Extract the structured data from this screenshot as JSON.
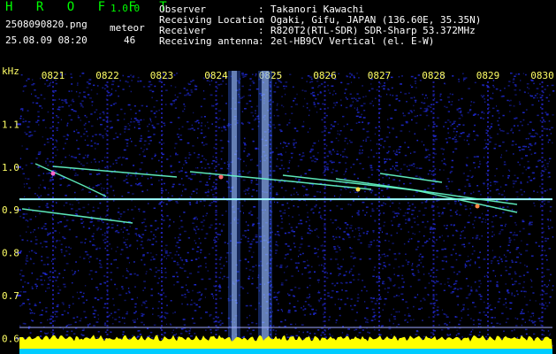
{
  "header": {
    "app_name": "H R O F F T",
    "version": "1.0.0",
    "filename": "2508090820.png",
    "datetime": "25.08.09 08:20",
    "meteor_label": "meteor",
    "meteor_count": "46",
    "info": [
      {
        "label": "Observer",
        "sep": ":",
        "value": "Takanori Kawachi"
      },
      {
        "label": "Receiving Location",
        "sep": ":",
        "value": "Ogaki, Gifu, JAPAN (136.60E, 35.35N)"
      },
      {
        "label": "Receiver",
        "sep": ":",
        "value": "R820T2(RTL-SDR) SDR-Sharp 53.372MHz"
      },
      {
        "label": "Receiving antenna",
        "sep": ":",
        "value": "2el-HB9CV Vertical (el. E-W)"
      }
    ]
  },
  "chart_data": {
    "type": "heatmap",
    "ylabel": "kHz",
    "x_ticks": [
      "0821",
      "0822",
      "0823",
      "0824",
      "0825",
      "0826",
      "0827",
      "0828",
      "0829",
      "0830"
    ],
    "y_ticks": [
      "1.1",
      "1.0",
      "0.9",
      "0.8",
      "0.7",
      "0.6"
    ],
    "ylim": [
      0.58,
      1.2
    ],
    "carrier_khz": 0.925,
    "colors": {
      "background": "#000000",
      "noise": "#1a1aa0",
      "text_green": "#00ff00",
      "tick_yellow": "#ffff66",
      "level_bar": "#ffff00",
      "floor": "#00ccff"
    }
  }
}
